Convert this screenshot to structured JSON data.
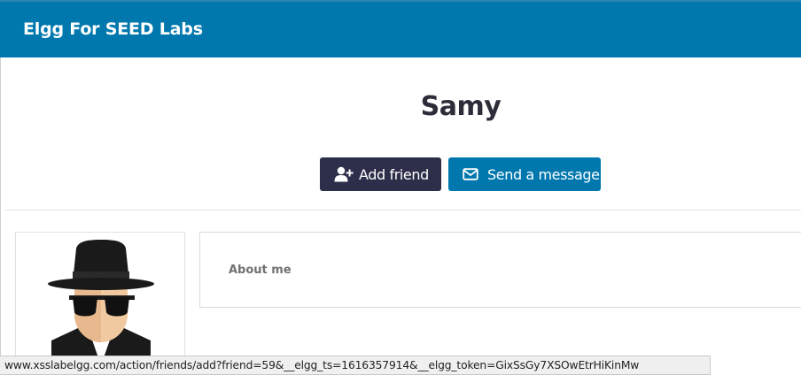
{
  "header": {
    "site_title": "Elgg For SEED Labs",
    "background": "#0078ae"
  },
  "profile": {
    "name": "Samy",
    "add_friend_label": "Add friend",
    "send_message_label": "Send a message",
    "about_label": "About me"
  },
  "icons": {
    "add_friend": "user-plus-icon",
    "send_message": "envelope-icon",
    "avatar": "spy-hat-sunglasses-avatar"
  },
  "colors": {
    "add_friend_button": "#2d2e4a",
    "send_message_button": "#0078ae"
  },
  "statusbar": {
    "url": "www.xsslabelgg.com/action/friends/add?friend=59&__elgg_ts=1616357914&__elgg_token=GixSsGy7XSOwEtrHiKinMw"
  }
}
